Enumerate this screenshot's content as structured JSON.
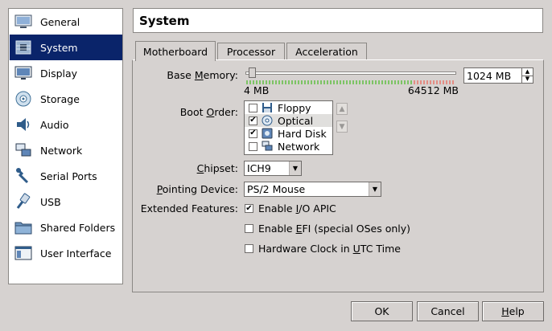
{
  "sidebar": {
    "items": [
      {
        "label": "General",
        "icon": "general-icon"
      },
      {
        "label": "System",
        "icon": "system-icon",
        "selected": true
      },
      {
        "label": "Display",
        "icon": "display-icon"
      },
      {
        "label": "Storage",
        "icon": "storage-icon"
      },
      {
        "label": "Audio",
        "icon": "audio-icon"
      },
      {
        "label": "Network",
        "icon": "network-icon"
      },
      {
        "label": "Serial Ports",
        "icon": "serial-ports-icon"
      },
      {
        "label": "USB",
        "icon": "usb-icon"
      },
      {
        "label": "Shared Folders",
        "icon": "shared-folders-icon"
      },
      {
        "label": "User Interface",
        "icon": "user-interface-icon"
      }
    ]
  },
  "header": {
    "title": "System"
  },
  "tabs": [
    {
      "label": "Motherboard",
      "active": true
    },
    {
      "label": "Processor"
    },
    {
      "label": "Acceleration"
    }
  ],
  "motherboard": {
    "base_memory": {
      "label_pre": "Base ",
      "label_u": "M",
      "label_post": "emory:",
      "min_label": "4 MB",
      "max_label": "64512 MB",
      "value": "1024 MB"
    },
    "boot_order": {
      "label_pre": "Boot ",
      "label_u": "O",
      "label_post": "rder:",
      "items": [
        {
          "label": "Floppy",
          "checked": false,
          "icon": "floppy-icon"
        },
        {
          "label": "Optical",
          "checked": true,
          "icon": "optical-icon"
        },
        {
          "label": "Hard Disk",
          "checked": true,
          "icon": "hard-disk-icon"
        },
        {
          "label": "Network",
          "checked": false,
          "icon": "network-icon"
        }
      ]
    },
    "chipset": {
      "label_u": "C",
      "label_post": "hipset:",
      "value": "ICH9"
    },
    "pointing_device": {
      "label_u": "P",
      "label_post": "ointing Device:",
      "value": "PS/2 Mouse"
    },
    "extended_features": {
      "label": "Extended Features:",
      "items": [
        {
          "pre": "Enable ",
          "u": "I",
          "post": "/O APIC",
          "checked": true
        },
        {
          "pre": "Enable ",
          "u": "E",
          "post": "FI (special OSes only)",
          "checked": false
        },
        {
          "pre": "Hardware Clock in ",
          "u": "U",
          "post": "TC Time",
          "checked": false
        }
      ]
    }
  },
  "buttons": {
    "ok": "OK",
    "cancel": "Cancel",
    "help_u": "H",
    "help_post": "elp"
  },
  "colors": {
    "selection": "#0a246a",
    "tick_green": "#7dc465",
    "tick_red": "#e38d84"
  }
}
